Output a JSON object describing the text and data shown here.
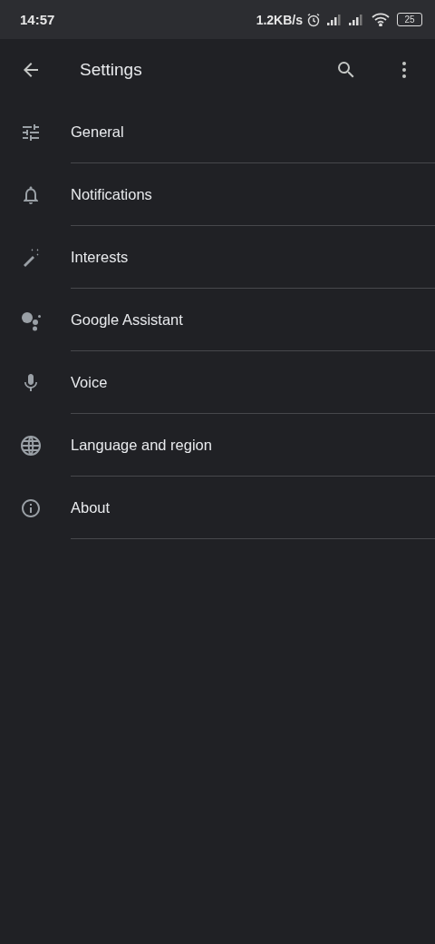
{
  "status_bar": {
    "time": "14:57",
    "speed": "1.2KB/s",
    "battery": "25"
  },
  "app_bar": {
    "title": "Settings"
  },
  "items": [
    {
      "label": "General",
      "kind": "sliders"
    },
    {
      "label": "Notifications",
      "kind": "bell"
    },
    {
      "label": "Interests",
      "kind": "wand"
    },
    {
      "label": "Google Assistant",
      "kind": "dots"
    },
    {
      "label": "Voice",
      "kind": "mic"
    },
    {
      "label": "Language and region",
      "kind": "globe"
    },
    {
      "label": "About",
      "kind": "info"
    }
  ]
}
